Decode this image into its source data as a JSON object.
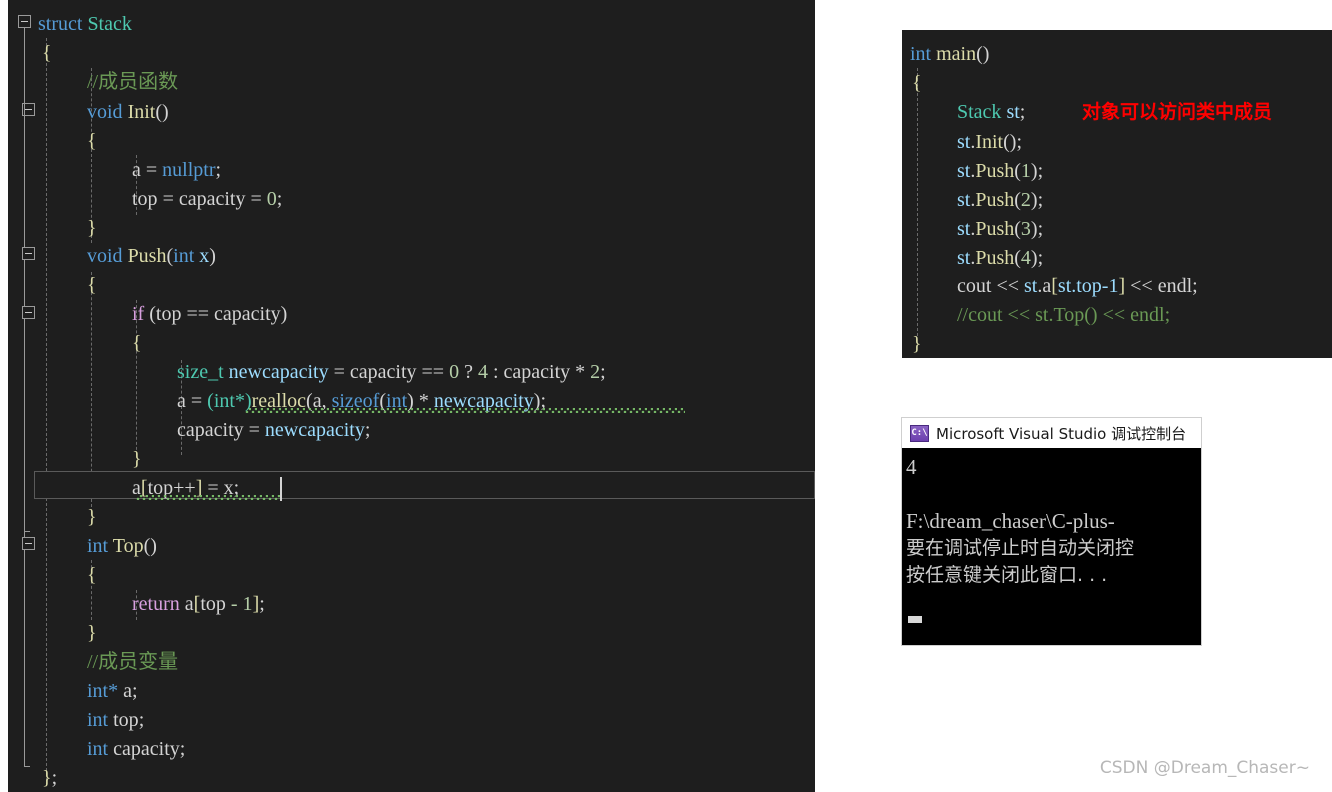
{
  "editor": {
    "name": "visual-studio-code-editor",
    "background": "#1e1e1e",
    "lines": [
      {
        "id": "l1",
        "text": "struct Stack"
      },
      {
        "id": "l2",
        "text": "{"
      },
      {
        "id": "l3",
        "text": "//成员函数"
      },
      {
        "id": "l4",
        "text": "void Init()"
      },
      {
        "id": "l5",
        "text": "{"
      },
      {
        "id": "l6",
        "text": "a = nullptr;"
      },
      {
        "id": "l7",
        "text": "top = capacity = 0;"
      },
      {
        "id": "l8",
        "text": "}"
      },
      {
        "id": "l9",
        "text": "void Push(int x)"
      },
      {
        "id": "l10",
        "text": "{"
      },
      {
        "id": "l11",
        "text": "if (top == capacity)"
      },
      {
        "id": "l12",
        "text": "{"
      },
      {
        "id": "l13",
        "text": "size_t newcapacity = capacity == 0 ? 4 : capacity * 2;"
      },
      {
        "id": "l14",
        "text": "a = (int*)realloc(a, sizeof(int) * newcapacity);"
      },
      {
        "id": "l15",
        "text": "capacity = newcapacity;"
      },
      {
        "id": "l16",
        "text": "}"
      },
      {
        "id": "l17",
        "text": "a[top++] = x;"
      },
      {
        "id": "l18",
        "text": "}"
      },
      {
        "id": "l19",
        "text": "int Top()"
      },
      {
        "id": "l20",
        "text": "{"
      },
      {
        "id": "l21",
        "text": "return a[top - 1];"
      },
      {
        "id": "l22",
        "text": "}"
      },
      {
        "id": "l23",
        "text": "//成员变量"
      },
      {
        "id": "l24",
        "text": "int* a;"
      },
      {
        "id": "l25",
        "text": "int top;"
      },
      {
        "id": "l26",
        "text": "int capacity;"
      },
      {
        "id": "l27",
        "text": "};"
      }
    ],
    "tokens": {
      "struct": "struct",
      "stack_type": "Stack",
      "brace_open": "{",
      "brace_close": "}",
      "comment_member_functions": "//成员函数",
      "comment_member_variables": "//成员变量",
      "void": "void",
      "init": "Init",
      "parens_empty": "()",
      "a": "a",
      "assign": " = ",
      "nullptr": "nullptr",
      "semicolon": ";",
      "top": "top",
      "capacity": "capacity",
      "zero": "0",
      "push": "Push",
      "paren_open": "(",
      "paren_close": ")",
      "int": "int",
      "x": "x",
      "if": "if",
      "eqeq": " == ",
      "size_t": "size_t",
      "newcapacity": "newcapacity",
      "question": " ? ",
      "four": "4",
      "colon": " : ",
      "times": " * ",
      "two": "2",
      "cast_int_ptr": "(int*)",
      "realloc": "realloc",
      "sizeof": "sizeof",
      "comma": ", ",
      "return": "return",
      "minus_one": " - 1",
      "bracket_open": "[",
      "bracket_close": "]",
      "topincr": "top++",
      "int_star": "int*",
      "Top": "Top"
    }
  },
  "main_panel": {
    "name": "main-function-snippet",
    "lines": [
      {
        "id": "m1",
        "text": "int main()"
      },
      {
        "id": "m2",
        "text": "{"
      },
      {
        "id": "m3",
        "text": "Stack st;"
      },
      {
        "id": "m4",
        "text": "st.Init();"
      },
      {
        "id": "m5",
        "text": "st.Push(1);"
      },
      {
        "id": "m6",
        "text": "st.Push(2);"
      },
      {
        "id": "m7",
        "text": "st.Push(3);"
      },
      {
        "id": "m8",
        "text": "st.Push(4);"
      },
      {
        "id": "m9",
        "text": "cout << st.a[st.top-1] << endl;"
      },
      {
        "id": "m10",
        "text": "//cout << st.Top() << endl;"
      },
      {
        "id": "m11",
        "text": "}"
      }
    ],
    "annotation": {
      "text": "对象可以访问类中成员",
      "color": "#ff0000"
    },
    "tokens": {
      "int": "int",
      "main": "main",
      "parens_empty": "()",
      "brace_open": "{",
      "brace_close": "}",
      "stack_type": "Stack",
      "st": "st",
      "semicolon": ";",
      "dot": ".",
      "init": "Init",
      "push": "Push",
      "one": "1",
      "two": "2",
      "three": "3",
      "four": "4",
      "cout": "cout",
      "shift": " << ",
      "a": "a",
      "top_expr": "st.top-1",
      "endl": "endl",
      "bracket_open": "[",
      "bracket_close": "]",
      "paren_open": "(",
      "paren_close": ")",
      "comment_cout_top": "//cout << st.Top() << endl;"
    }
  },
  "console": {
    "name": "visual-studio-debug-console",
    "icon": "console-window-icon",
    "icon_glyph": "C:\\",
    "title": "Microsoft Visual Studio 调试控制台",
    "output_lines": [
      "4",
      "",
      "F:\\dream_chaser\\C-plus-",
      "要在调试停止时自动关闭控",
      "按任意键关闭此窗口. . ."
    ]
  },
  "watermark": {
    "name": "csdn-watermark",
    "text": "CSDN @Dream_Chaser~"
  },
  "colors": {
    "editor_bg": "#1e1e1e",
    "keyword": "#569cd6",
    "control_keyword": "#d8a0df",
    "type": "#4ec9b0",
    "function": "#dcdcaa",
    "identifier": "#9cdcfe",
    "plain": "#d4d4d4",
    "number": "#b5cea8",
    "comment": "#6a9955",
    "annotation_red": "#ff0000",
    "squiggle_green": "#7ac06a",
    "console_bg": "#000000",
    "console_titlebar": "#ffffff"
  }
}
